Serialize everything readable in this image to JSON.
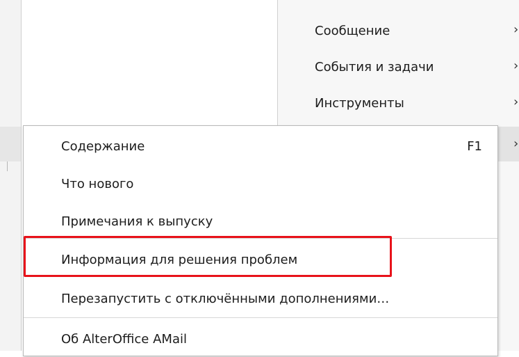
{
  "parent_menu": {
    "items": [
      {
        "label": "Сообщение",
        "chevron": "›"
      },
      {
        "label": "События и задачи",
        "chevron": "›"
      },
      {
        "label": "Инструменты",
        "chevron": "›"
      },
      {
        "label": "",
        "chevron": "›"
      }
    ]
  },
  "submenu": {
    "items": [
      {
        "label": "Содержание",
        "shortcut": "F1"
      },
      {
        "label": "Что нового",
        "shortcut": ""
      },
      {
        "label": "Примечания к выпуску",
        "shortcut": ""
      },
      {
        "label": "Информация для решения проблем",
        "shortcut": ""
      },
      {
        "label": "Перезапустить с отключёнными дополнениями…",
        "shortcut": ""
      },
      {
        "label": "Об AlterOffice AMail",
        "shortcut": ""
      }
    ]
  },
  "colors": {
    "highlight_border": "#e8121a",
    "menu_bg": "#ffffff",
    "parent_menu_bg": "#f7f7f7",
    "active_item_bg": "#e3e3e3"
  }
}
